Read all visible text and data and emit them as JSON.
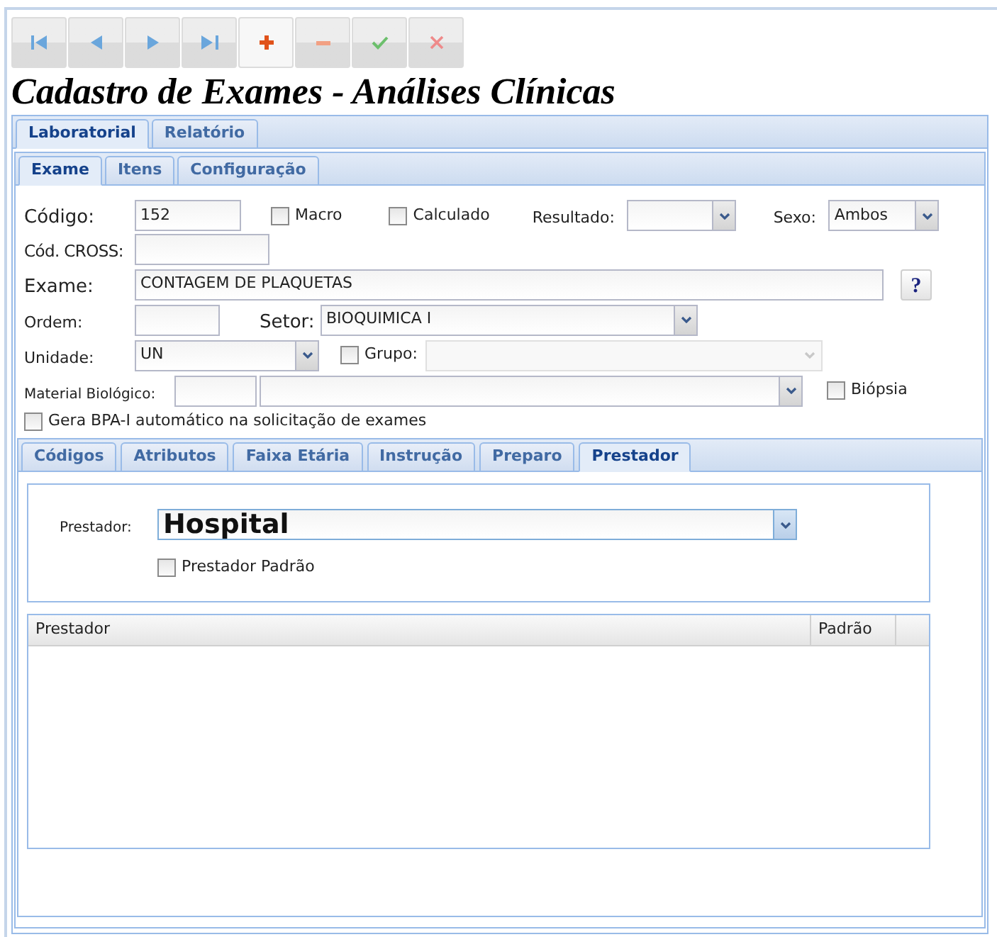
{
  "toolbar": [
    {
      "kind": "first",
      "highlighted": false
    },
    {
      "kind": "previous",
      "highlighted": false
    },
    {
      "kind": "next",
      "highlighted": false
    },
    {
      "kind": "last",
      "highlighted": false
    },
    {
      "kind": "add",
      "highlighted": true
    },
    {
      "kind": "remove",
      "highlighted": false
    },
    {
      "kind": "confirm",
      "highlighted": false
    },
    {
      "kind": "cancel",
      "highlighted": false
    }
  ],
  "title": "Cadastro de Exames - Análises Clínicas",
  "main_tabs": [
    {
      "label": "Laboratorial",
      "selected": true
    },
    {
      "label": "Relatório",
      "selected": false
    }
  ],
  "sub_tabs": [
    {
      "label": "Exame",
      "selected": true
    },
    {
      "label": "Itens",
      "selected": false
    },
    {
      "label": "Configuração",
      "selected": false
    }
  ],
  "form": {
    "codigo": {
      "label": "Código:",
      "value": "152"
    },
    "macro": {
      "label": "Macro",
      "checked": false
    },
    "calculado": {
      "label": "Calculado",
      "checked": false
    },
    "resultado": {
      "label": "Resultado:"
    },
    "sexo": {
      "label": "Sexo:",
      "value": "Ambos"
    },
    "cod_cross": {
      "label": "Cód. CROSS:"
    },
    "exame": {
      "label": "Exame:",
      "value": "CONTAGEM DE PLAQUETAS"
    },
    "help_button": "?",
    "ordem": {
      "label": "Ordem:"
    },
    "setor": {
      "label": "Setor:",
      "value": "BIOQUIMICA I"
    },
    "unidade": {
      "label": "Unidade:",
      "value": "UN"
    },
    "grupo": {
      "label": "Grupo:",
      "checked": false,
      "field_disabled": true
    },
    "material": {
      "label": "Material Biológico:"
    },
    "biopsia": {
      "label": "Biópsia",
      "checked": false
    },
    "gera_bpa": {
      "label": "Gera BPA-I automático na solicitação de exames",
      "checked": false
    }
  },
  "detail_tabs": [
    {
      "label": "Códigos",
      "selected": false
    },
    {
      "label": "Atributos",
      "selected": false
    },
    {
      "label": "Faixa Etária",
      "selected": false
    },
    {
      "label": "Instrução",
      "selected": false
    },
    {
      "label": "Preparo",
      "selected": false
    },
    {
      "label": "Prestador",
      "selected": true
    }
  ],
  "prestador": {
    "label": "Prestador:",
    "value": "Hospital",
    "padrao": {
      "label": "Prestador Padrão",
      "checked": false
    }
  },
  "table": {
    "columns": [
      "Prestador",
      "Padrão"
    ]
  }
}
